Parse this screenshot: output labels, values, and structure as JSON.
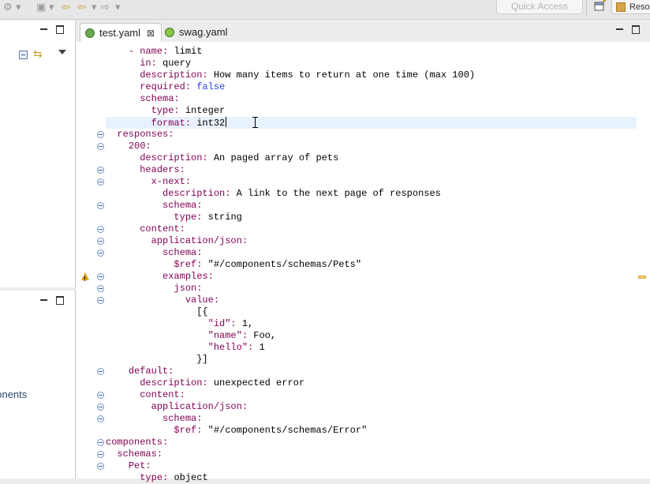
{
  "toolbar": {
    "quick_access_placeholder": "Quick Access",
    "perspective_label": "Reso"
  },
  "left_panel": {
    "bottom_label": "ponents"
  },
  "tabs": [
    {
      "label": "test.yaml",
      "active": true
    },
    {
      "label": "swag.yaml",
      "active": false
    }
  ],
  "editor": {
    "lines": [
      {
        "indent": "    ",
        "dash": "- ",
        "key": "name",
        "sep": ": ",
        "value": "limit",
        "fold": false,
        "warn": false
      },
      {
        "indent": "      ",
        "dash": "",
        "key": "in",
        "sep": ": ",
        "value": "query",
        "fold": false,
        "warn": false
      },
      {
        "indent": "      ",
        "dash": "",
        "key": "description",
        "sep": ": ",
        "value": "How many items to return at one time (max 100)",
        "fold": false,
        "warn": false
      },
      {
        "indent": "      ",
        "dash": "",
        "key": "required",
        "sep": ": ",
        "value": "false",
        "vclass": "bool",
        "fold": false,
        "warn": false
      },
      {
        "indent": "      ",
        "dash": "",
        "key": "schema",
        "sep": ":",
        "value": "",
        "fold": false,
        "warn": false
      },
      {
        "indent": "        ",
        "dash": "",
        "key": "type",
        "sep": ": ",
        "value": "integer",
        "fold": false,
        "warn": false
      },
      {
        "indent": "        ",
        "dash": "",
        "key": "format",
        "sep": ": ",
        "value": "int32",
        "fold": false,
        "warn": false,
        "caret": true
      },
      {
        "indent": "  ",
        "dash": "",
        "key": "responses",
        "sep": ":",
        "value": "",
        "fold": true,
        "warn": false
      },
      {
        "indent": "    ",
        "dash": "",
        "key": "200",
        "sep": ":",
        "value": "",
        "fold": true,
        "warn": false
      },
      {
        "indent": "      ",
        "dash": "",
        "key": "description",
        "sep": ": ",
        "value": "An paged array of pets",
        "fold": false,
        "warn": false
      },
      {
        "indent": "      ",
        "dash": "",
        "key": "headers",
        "sep": ":",
        "value": "",
        "fold": true,
        "warn": false
      },
      {
        "indent": "        ",
        "dash": "",
        "key": "x-next",
        "sep": ":",
        "value": "",
        "fold": true,
        "warn": false
      },
      {
        "indent": "          ",
        "dash": "",
        "key": "description",
        "sep": ": ",
        "value": "A link to the next page of responses",
        "fold": false,
        "warn": false
      },
      {
        "indent": "          ",
        "dash": "",
        "key": "schema",
        "sep": ":",
        "value": "",
        "fold": true,
        "warn": false
      },
      {
        "indent": "            ",
        "dash": "",
        "key": "type",
        "sep": ": ",
        "value": "string",
        "fold": false,
        "warn": false
      },
      {
        "indent": "      ",
        "dash": "",
        "key": "content",
        "sep": ":",
        "value": "",
        "fold": true,
        "warn": false
      },
      {
        "indent": "        ",
        "dash": "",
        "key": "application/json",
        "sep": ":",
        "value": "",
        "fold": true,
        "warn": false
      },
      {
        "indent": "          ",
        "dash": "",
        "key": "schema",
        "sep": ":",
        "value": "",
        "fold": true,
        "warn": false
      },
      {
        "indent": "            ",
        "dash": "",
        "key": "$ref",
        "sep": ": ",
        "value": "\"#/components/schemas/Pets\"",
        "fold": false,
        "warn": false
      },
      {
        "indent": "          ",
        "dash": "",
        "key": "examples",
        "sep": ":",
        "value": "",
        "fold": true,
        "warn": true
      },
      {
        "indent": "            ",
        "dash": "",
        "key": "json",
        "sep": ":",
        "value": "",
        "fold": true,
        "warn": false
      },
      {
        "indent": "              ",
        "dash": "",
        "key": "value",
        "sep": ":",
        "value": "",
        "fold": true,
        "warn": false
      },
      {
        "indent": "                ",
        "dash": "",
        "key": "",
        "sep": "",
        "value": "[{",
        "fold": false,
        "warn": false
      },
      {
        "indent": "                  ",
        "dash": "",
        "key": "\"id\"",
        "sep": ": ",
        "value": "1,",
        "fold": false,
        "warn": false
      },
      {
        "indent": "                  ",
        "dash": "",
        "key": "\"name\"",
        "sep": ": ",
        "value": "Foo,",
        "fold": false,
        "warn": false
      },
      {
        "indent": "                  ",
        "dash": "",
        "key": "\"hello\"",
        "sep": ": ",
        "value": "1",
        "fold": false,
        "warn": false
      },
      {
        "indent": "                ",
        "dash": "",
        "key": "",
        "sep": "",
        "value": "}]",
        "fold": false,
        "warn": false
      },
      {
        "indent": "    ",
        "dash": "",
        "key": "default",
        "sep": ":",
        "value": "",
        "fold": true,
        "warn": false
      },
      {
        "indent": "      ",
        "dash": "",
        "key": "description",
        "sep": ": ",
        "value": "unexpected error",
        "fold": false,
        "warn": false
      },
      {
        "indent": "      ",
        "dash": "",
        "key": "content",
        "sep": ":",
        "value": "",
        "fold": true,
        "warn": false
      },
      {
        "indent": "        ",
        "dash": "",
        "key": "application/json",
        "sep": ":",
        "value": "",
        "fold": true,
        "warn": false
      },
      {
        "indent": "          ",
        "dash": "",
        "key": "schema",
        "sep": ":",
        "value": "",
        "fold": true,
        "warn": false
      },
      {
        "indent": "            ",
        "dash": "",
        "key": "$ref",
        "sep": ": ",
        "value": "\"#/components/schemas/Error\"",
        "fold": false,
        "warn": false
      },
      {
        "indent": "",
        "dash": "",
        "key": "components",
        "sep": ":",
        "value": "",
        "fold": true,
        "warn": false
      },
      {
        "indent": "  ",
        "dash": "",
        "key": "schemas",
        "sep": ":",
        "value": "",
        "fold": true,
        "warn": false
      },
      {
        "indent": "    ",
        "dash": "",
        "key": "Pet",
        "sep": ":",
        "value": "",
        "fold": true,
        "warn": false
      },
      {
        "indent": "      ",
        "dash": "",
        "key": "type",
        "sep": ": ",
        "value": "object",
        "fold": false,
        "warn": false
      }
    ]
  }
}
